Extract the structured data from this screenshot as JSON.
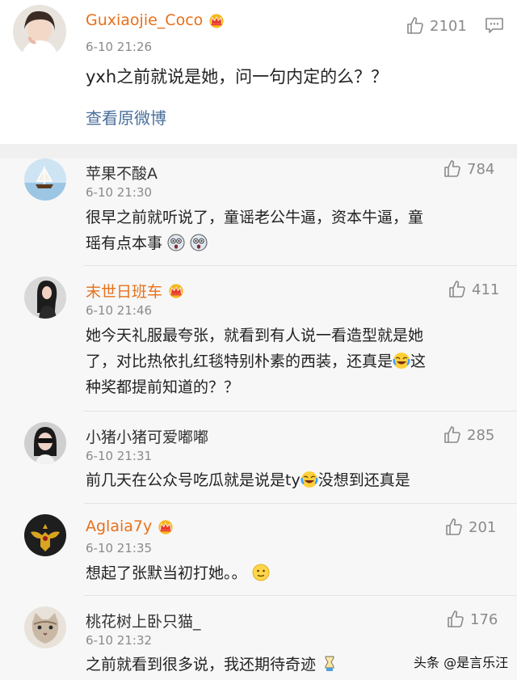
{
  "main": {
    "username": "Guxiaojie_Coco",
    "time": "6-10 21:26",
    "text": "yxh之前就说是她，问一句内定的么？？",
    "likes": "2101",
    "view_link": "查看原微博"
  },
  "replies": [
    {
      "username": "苹果不酸A",
      "time": "6-10 21:30",
      "likes": "784",
      "lines": [
        "很早之前就听说了，童谣老公牛逼，资本牛逼，童",
        "瑶有点本事"
      ]
    },
    {
      "username": "末世日班车",
      "time": "6-10 21:46",
      "likes": "411",
      "lines": [
        "她今天礼服最夸张，就看到有人说一看造型就是她",
        "了，对比热依扎红毯特别朴素的西装，还真是",
        "这",
        "种奖都提前知道的？？"
      ]
    },
    {
      "username": "小猪小猪可爱嘟嘟",
      "time": "6-10 21:31",
      "likes": "285",
      "lines": [
        "前几天在公众号吃瓜就是说是ty",
        "没想到还真是"
      ]
    },
    {
      "username": "Aglaia7y",
      "time": "6-10 21:35",
      "likes": "201",
      "lines": [
        "想起了张默当初打她。。"
      ]
    },
    {
      "username": "桃花树上卧只猫_",
      "time": "6-10 21:32",
      "likes": "176",
      "lines": [
        "之前就看到很多说，我还期待奇迹"
      ]
    }
  ],
  "watermark": "头条 @是言乐汪",
  "icons": {
    "like": "thumbs-up-icon",
    "comment": "comment-icon",
    "vip": "crown-icon"
  },
  "colors": {
    "vip_name": "#e8701a",
    "link": "#4a6f9a",
    "meta": "#8a8a8a"
  }
}
